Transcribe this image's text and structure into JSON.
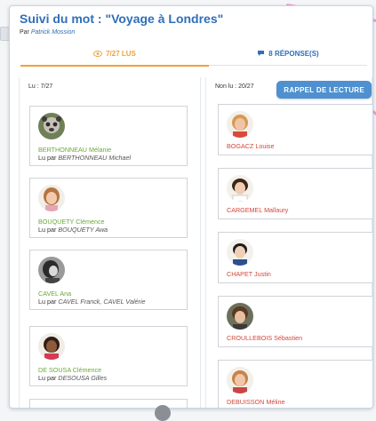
{
  "page": {
    "title": "Suivi du mot : \"Voyage à Londres\"",
    "by_prefix": "Par",
    "author": "Patrick Mossion"
  },
  "tabs": [
    {
      "label": "7/27 LUS",
      "icon": "eye-icon",
      "active": true
    },
    {
      "label": "8 RÉPONSE(S)",
      "icon": "chat-bubble-icon",
      "active": false
    }
  ],
  "read": {
    "header": "Lu : 7/27",
    "by_label": "Lu par",
    "items": [
      {
        "name": "BERTHONNEAU Mélanie",
        "by": "BERTHONNEAU Michael"
      },
      {
        "name": "BOUQUETY Clémence",
        "by": "BOUQUETY Awa"
      },
      {
        "name": "CAVEL Ana",
        "by": "CAVEL Franck, CAVEL Valérie"
      },
      {
        "name": "DE SOUSA Clémence",
        "by": "DESOUSA Gilles"
      }
    ]
  },
  "unread": {
    "header": "Non lu : 20/27",
    "reminder_button": "RAPPEL DE LECTURE",
    "items": [
      {
        "name": "BOGACZ Louise"
      },
      {
        "name": "CARGEMEL Mallaury"
      },
      {
        "name": "CHAPET Justin"
      },
      {
        "name": "CROULLEBOIS Sébastien"
      },
      {
        "name": "DEBUISSON Méline"
      }
    ]
  },
  "colors": {
    "title": "#2f6fb8",
    "active_tab": "#f0a03a",
    "read_name": "#6aa839",
    "unread_name": "#d2473d",
    "reminder_button": "#4e90d0"
  }
}
